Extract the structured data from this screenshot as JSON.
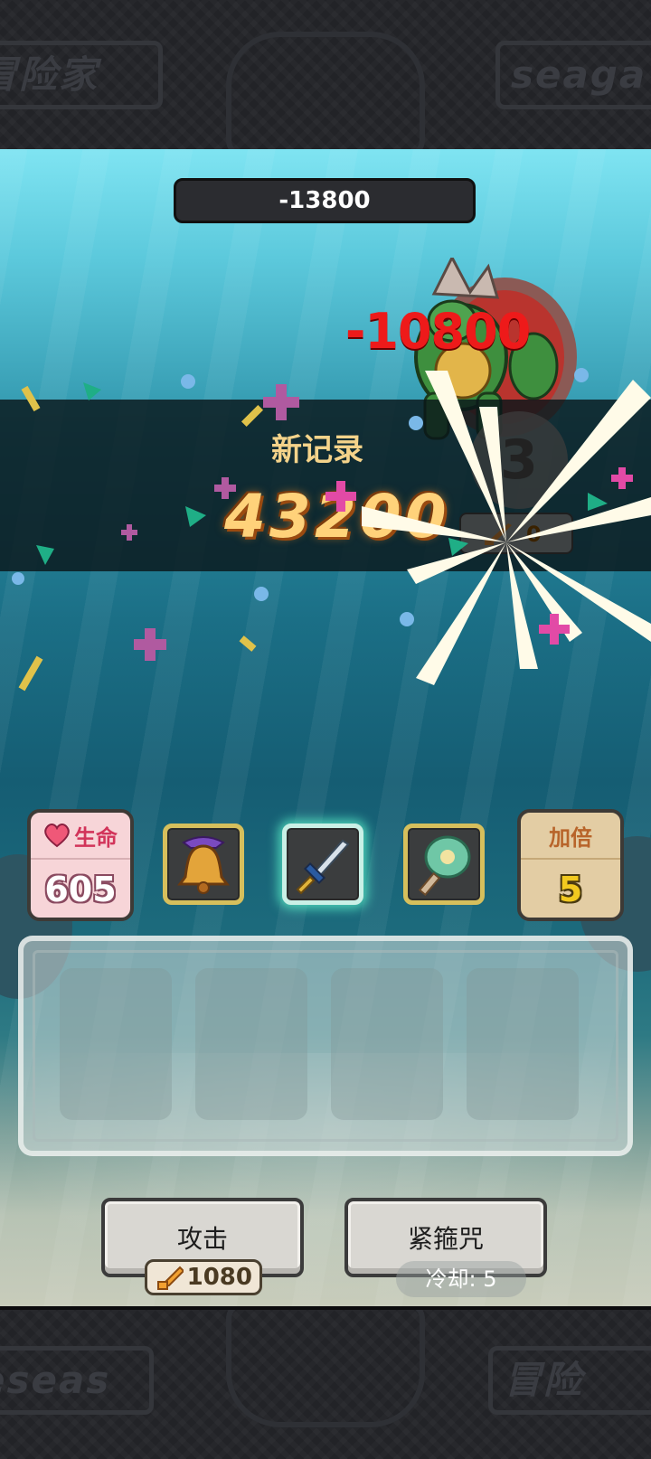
{
  "frame": {
    "top_left_plate": "冒险家",
    "top_right_plate": "seaga",
    "bottom_left_plate": "eseas",
    "bottom_right_plate": "冒险"
  },
  "battle": {
    "top_score": "-13800",
    "damage_popup": "-10800",
    "round": "3",
    "monster_attack": "0"
  },
  "record": {
    "label": "新记录",
    "score": "43200"
  },
  "stats": {
    "life_label": "生命",
    "life_value": "605",
    "multiplier_label": "加倍",
    "multiplier_value": "5"
  },
  "items": [
    {
      "icon": "bell-icon"
    },
    {
      "icon": "sword-icon",
      "selected": true
    },
    {
      "icon": "fan-icon"
    }
  ],
  "actions": {
    "attack_label": "攻击",
    "attack_cost": "1080",
    "curse_label": "紧箍咒",
    "cooldown_text": "冷却: 5"
  },
  "colors": {
    "damage": "#ee1a1a",
    "record": "#ffd27a",
    "selected_glow": "#5af0c8"
  }
}
